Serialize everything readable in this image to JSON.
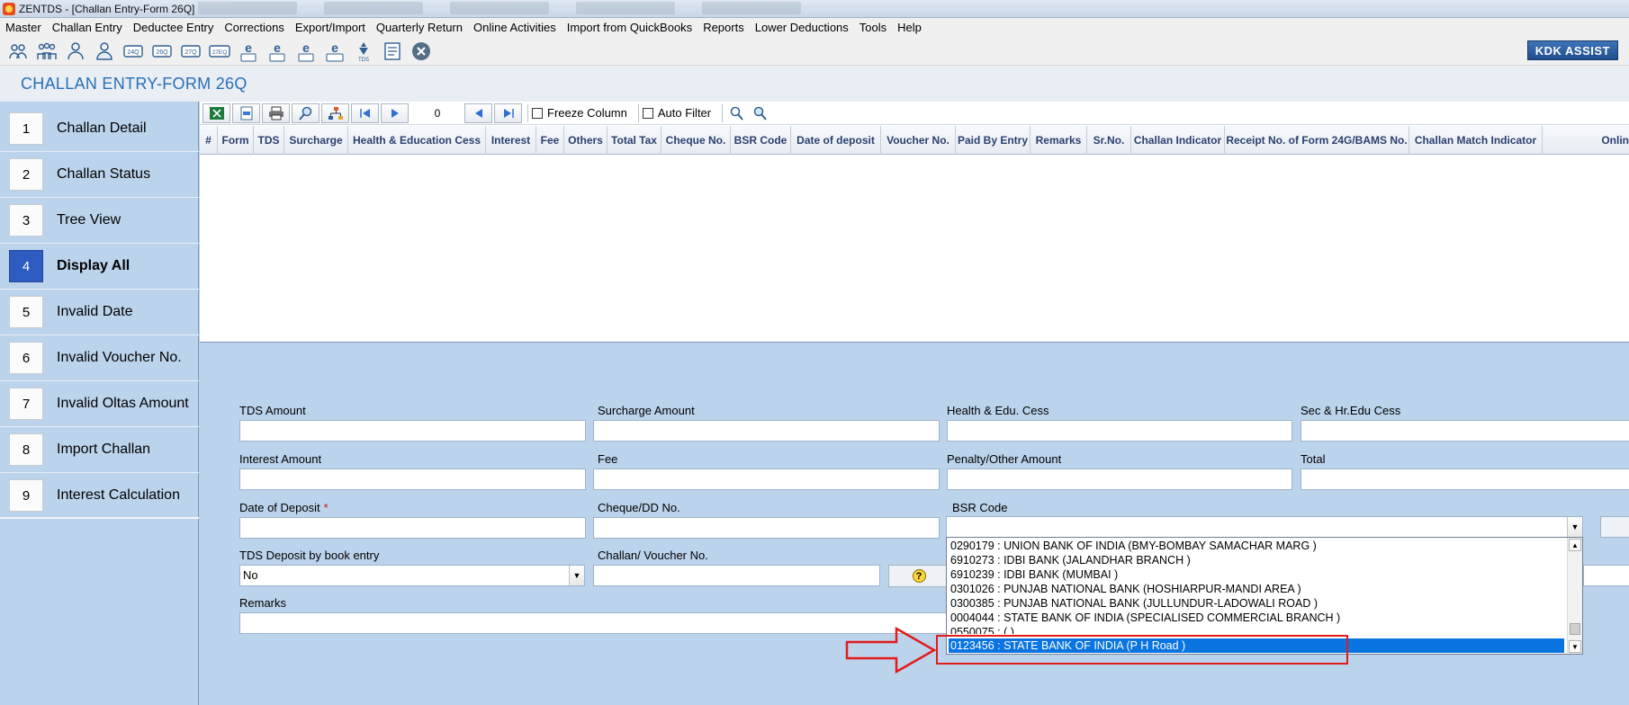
{
  "window": {
    "title": "ZENTDS - [Challan Entry-Form 26Q]"
  },
  "menu": [
    "Master",
    "Challan Entry",
    "Deductee Entry",
    "Corrections",
    "Export/Import",
    "Quarterly Return",
    "Online Activities",
    "Import from QuickBooks",
    "Reports",
    "Lower Deductions",
    "Tools",
    "Help"
  ],
  "toolbar": {
    "icons": [
      "users-icon",
      "group-icon",
      "deductee-icon",
      "person-icon",
      "form-24q-icon",
      "form-26q-icon",
      "form-27q-icon",
      "form-27eq-icon",
      "e-24q-icon",
      "e-26q-icon",
      "e-27q-icon",
      "e-27eq-icon",
      "tds-icon",
      "document-icon",
      "close-icon"
    ],
    "kdk_assist": "KDK ASSIST"
  },
  "form_title": "CHALLAN ENTRY-FORM 26Q",
  "sidebar": {
    "items": [
      {
        "num": "1",
        "label": "Challan Detail"
      },
      {
        "num": "2",
        "label": "Challan Status"
      },
      {
        "num": "3",
        "label": "Tree View"
      },
      {
        "num": "4",
        "label": "Display All"
      },
      {
        "num": "5",
        "label": "Invalid Date"
      },
      {
        "num": "6",
        "label": "Invalid Voucher No."
      },
      {
        "num": "7",
        "label": "Invalid Oltas Amount"
      },
      {
        "num": "8",
        "label": "Import Challan"
      },
      {
        "num": "9",
        "label": "Interest Calculation"
      }
    ],
    "active_index": 3
  },
  "grid": {
    "record_count": "0",
    "freeze_column_label": "Freeze Column",
    "auto_filter_label": "Auto Filter",
    "columns": [
      "#",
      "Form",
      "TDS",
      "Surcharge",
      "Health & Education Cess",
      "Interest",
      "Fee",
      "Others",
      "Total Tax",
      "Cheque No.",
      "BSR Code",
      "Date of deposit",
      "Voucher No.",
      "Paid By Entry",
      "Remarks",
      "Sr.No.",
      "Challan Indicator",
      "Receipt No. of Form 24G/BAMS No.",
      "Challan Match Indicator",
      "Onlin"
    ]
  },
  "form": {
    "tds_amount_label": "TDS Amount",
    "surcharge_amount_label": "Surcharge Amount",
    "health_edu_cess_label": "Health & Edu. Cess",
    "sec_hr_edu_cess_label": "Sec & Hr.Edu Cess",
    "interest_amount_label": "Interest Amount",
    "fee_label": "Fee",
    "penalty_other_label": "Penalty/Other Amount",
    "total_label": "Total",
    "date_of_deposit_label": "Date of Deposit",
    "required_mark": "*",
    "cheque_dd_label": "Cheque/DD No.",
    "bsr_code_label": "BSR Code",
    "tds_book_entry_label": "TDS Deposit by book entry",
    "tds_book_entry_value": "No",
    "challan_voucher_label": "Challan/ Voucher No.",
    "remarks_label": "Remarks"
  },
  "bsr_options": [
    "0290179 : UNION BANK OF INDIA (BMY-BOMBAY SAMACHAR MARG )",
    "6910273 : IDBI BANK (JALANDHAR BRANCH )",
    "6910239 : IDBI BANK (MUMBAI )",
    "0301026 : PUNJAB NATIONAL BANK  (HOSHIARPUR-MANDI AREA  )",
    "0300385 : PUNJAB NATIONAL BANK  (JULLUNDUR-LADOWALI ROAD  )",
    "0004044 : STATE BANK OF INDIA  (SPECIALISED COMMERCIAL BRANCH  )",
    "0550075 :  ( )",
    "0123456 : STATE BANK OF INDIA (P H Road )"
  ],
  "bsr_selected_index": 7,
  "colors": {
    "accent": "#2a6fb4",
    "active_item": "#2e5bbf",
    "selection": "#0a74e0",
    "annotation": "#e21b1b"
  }
}
